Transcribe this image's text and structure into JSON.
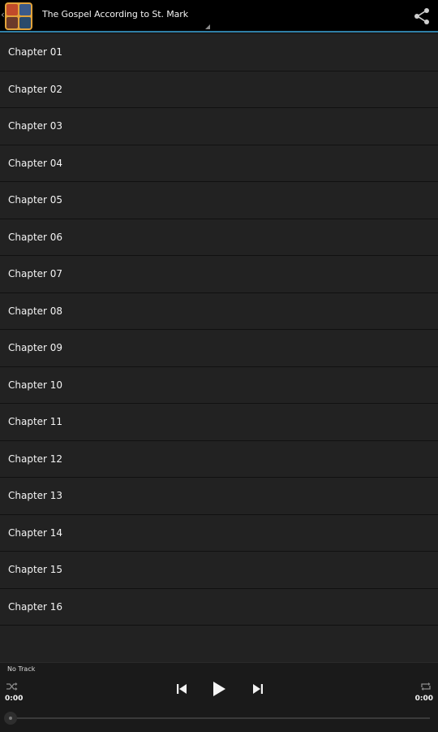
{
  "app": {
    "title": "The Gospel According to St. Mark"
  },
  "chapters": [
    {
      "label": "Chapter 01"
    },
    {
      "label": "Chapter 02"
    },
    {
      "label": "Chapter 03"
    },
    {
      "label": "Chapter 04"
    },
    {
      "label": "Chapter 05"
    },
    {
      "label": "Chapter 06"
    },
    {
      "label": "Chapter 07"
    },
    {
      "label": "Chapter 08"
    },
    {
      "label": "Chapter 09"
    },
    {
      "label": "Chapter 10"
    },
    {
      "label": "Chapter 11"
    },
    {
      "label": "Chapter 12"
    },
    {
      "label": "Chapter 13"
    },
    {
      "label": "Chapter 14"
    },
    {
      "label": "Chapter 15"
    },
    {
      "label": "Chapter 16"
    }
  ],
  "player": {
    "track_name": "No Track",
    "elapsed": "0:00",
    "duration": "0:00",
    "progress": 0
  },
  "icons": {
    "app": "app-icon",
    "share": "share-icon",
    "shuffle": "shuffle-icon",
    "repeat": "repeat-icon",
    "previous": "skip-previous-icon",
    "play": "play-icon",
    "next": "skip-next-icon"
  },
  "colors": {
    "actionbar_bg": "#000000",
    "accent_line": "#2f7fa6",
    "list_bg": "#222222",
    "text": "#f3f3f3"
  }
}
